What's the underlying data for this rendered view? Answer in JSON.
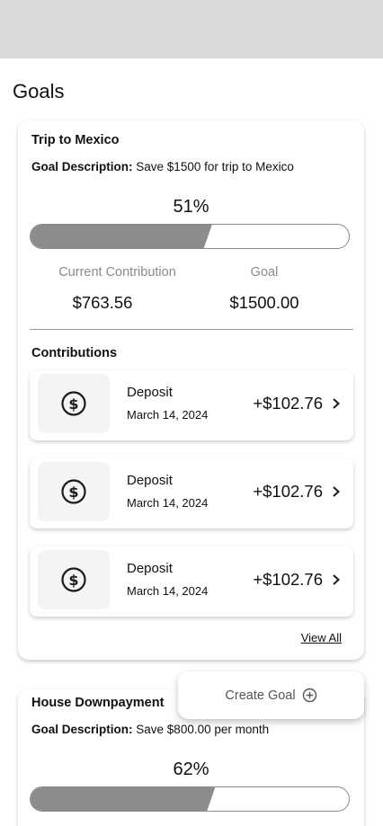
{
  "page": {
    "title": "Goals"
  },
  "goals": [
    {
      "name": "Trip to Mexico",
      "description_label": "Goal Description:",
      "description": "Save $1500 for trip to Mexico",
      "progress_text": "51%",
      "progress_fraction": 0.57,
      "contribution_label": "Current Contribution",
      "contribution_value": "$763.56",
      "goal_label": "Goal",
      "goal_value": "$1500.00",
      "contributions_title": "Contributions",
      "contributions": [
        {
          "type": "Deposit",
          "date": "March 14, 2024",
          "amount": "+$102.76",
          "icon": "dollar-circle-icon"
        },
        {
          "type": "Deposit",
          "date": "March 14, 2024",
          "amount": "+$102.76",
          "icon": "dollar-circle-icon"
        },
        {
          "type": "Deposit",
          "date": "March 14, 2024",
          "amount": "+$102.76",
          "icon": "dollar-circle-icon"
        }
      ],
      "view_all_label": "View All"
    },
    {
      "name": "House Downpayment",
      "description_label": "Goal Description:",
      "description": "Save $800.00 per month",
      "progress_text": "62%",
      "progress_fraction": 0.58
    }
  ],
  "fab": {
    "label": "Create Goal",
    "icon": "plus-circle-icon"
  },
  "colors": {
    "status_bar": "#d9d9d9",
    "progress_fill": "#8c8c8c",
    "muted_text": "#8a8a8a"
  }
}
